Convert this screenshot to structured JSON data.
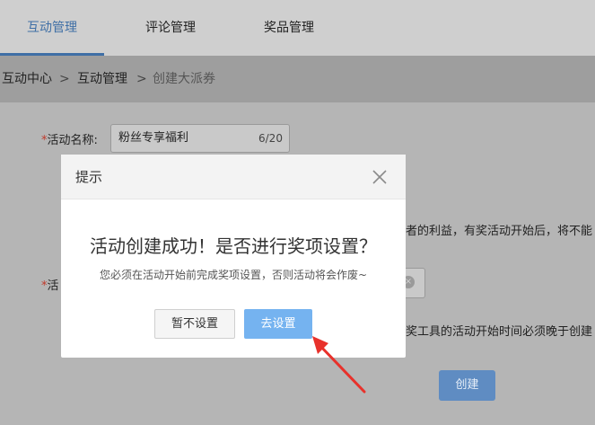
{
  "tabs": [
    {
      "label": "互动管理",
      "active": true
    },
    {
      "label": "评论管理",
      "active": false
    },
    {
      "label": "奖品管理",
      "active": false
    }
  ],
  "breadcrumb": {
    "items": [
      "互动中心",
      "互动管理",
      "创建大派券"
    ],
    "separator": ">"
  },
  "form": {
    "name_label": "活动名称:",
    "required_mark": "*",
    "name_value": "粉丝专享福利",
    "name_count": "6/20",
    "second_label_partial": "活",
    "partial_text_1": "者的利益，有奖活动开始后，将不能",
    "partial_text_2": "奖工具的活动开始时间必须晚于创建",
    "clear_icon": "×",
    "create_label": "创建"
  },
  "modal": {
    "title": "提示",
    "close_icon": "close-icon",
    "heading": "活动创建成功！是否进行奖项设置？",
    "description": "您必须在活动开始前完成奖项设置，否则活动将会作废~",
    "cancel_label": "暂不设置",
    "confirm_label": "去设置"
  },
  "colors": {
    "accent": "#3f6fa6",
    "primary_button": "#75b3f0",
    "annotation_arrow": "#e8312b"
  }
}
